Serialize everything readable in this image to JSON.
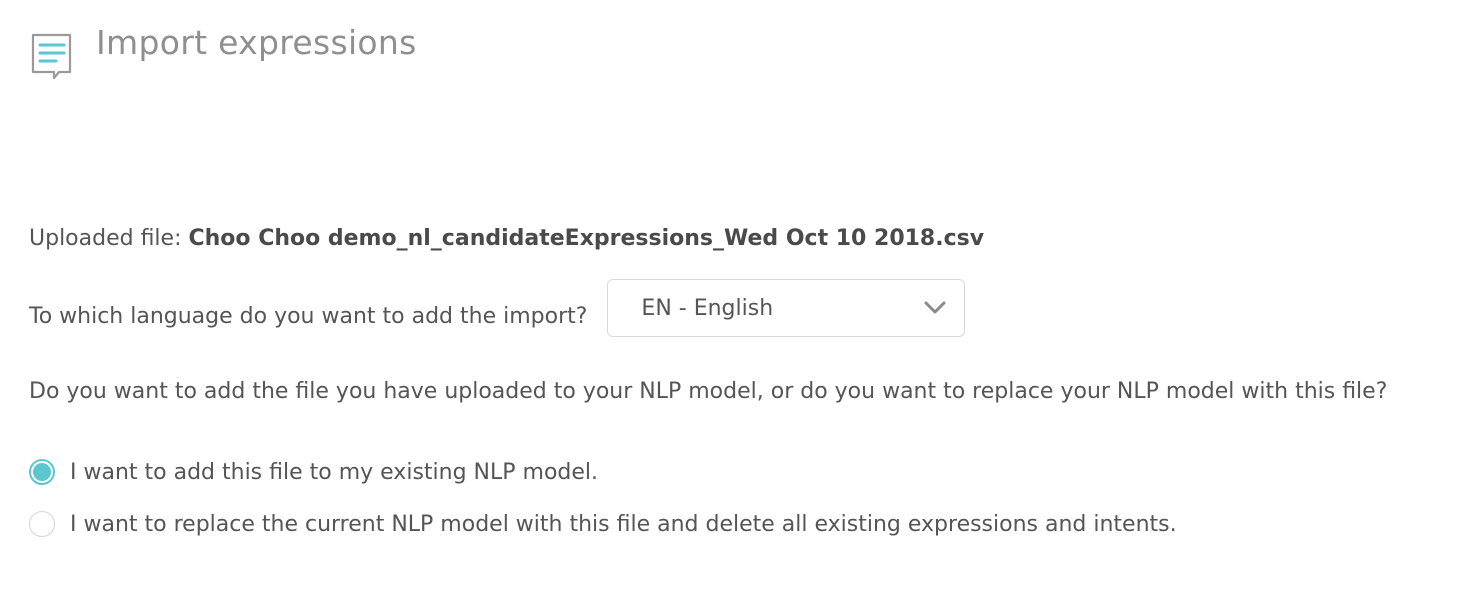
{
  "header": {
    "icon": "chat-document-icon",
    "title": "Import expressions"
  },
  "upload": {
    "label": "Uploaded file:",
    "filename": "Choo Choo demo_nl_candidateExpressions_Wed Oct 10 2018.csv"
  },
  "language": {
    "label": "To which language do you want to add the import?",
    "selected": "EN - English"
  },
  "mode": {
    "question": "Do you want to add the file you have uploaded to your NLP model, or do you want to replace your NLP model with this file?",
    "options": [
      {
        "label": "I want to add this file to my existing NLP model.",
        "checked": true
      },
      {
        "label": "I want to replace the current NLP model with this file and delete all existing expressions and intents.",
        "checked": false
      }
    ]
  },
  "colors": {
    "accent": "#5bc7d0",
    "icon_stroke": "#9a9a9a",
    "title": "#8f8f8f",
    "text": "#555555"
  }
}
